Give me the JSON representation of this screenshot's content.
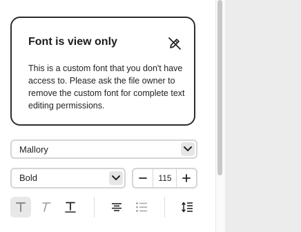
{
  "notice": {
    "title": "Font is view only",
    "body": "This is a custom font that you don't have access to. Please ask the file owner to remove the custom font for complete text editing permissions.",
    "icon": "pencil-slash-icon"
  },
  "font_family": {
    "value": "Mallory"
  },
  "font_weight": {
    "value": "Bold"
  },
  "font_size": {
    "value": "115"
  },
  "toolbar": {
    "tools": [
      "text-style-regular-icon",
      "text-style-italic-icon",
      "text-style-underline-icon",
      "align-center-icon",
      "bulleted-list-icon",
      "line-height-icon"
    ]
  },
  "colors": {
    "border": "#d5d5d5",
    "active_bg": "#e8e8e8",
    "canvas": "#ececec"
  }
}
